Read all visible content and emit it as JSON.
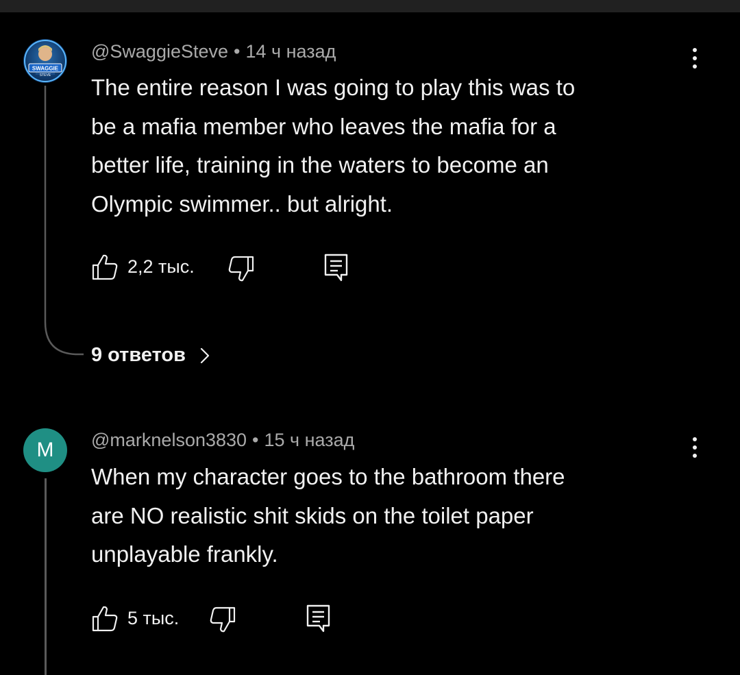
{
  "comments": [
    {
      "author": "@SwaggieSteve",
      "separator": "•",
      "time": "14 ч назад",
      "avatar_text": "SWAGGIE",
      "avatar_subtext": "STEVE",
      "text_lines": [
        "The entire reason I was going to play this was to",
        "be a mafia member who leaves the mafia for a",
        "better life, training in the waters to become an",
        "Olympic swimmer.. but alright."
      ],
      "likes": "2,2 тыс.",
      "replies_label": "9 ответов"
    },
    {
      "author": "@marknelson3830",
      "separator": "•",
      "time": "15 ч назад",
      "avatar_letter": "M",
      "text_lines": [
        "When my character goes to the bathroom there",
        "are NO realistic shit skids on the toilet paper",
        "unplayable frankly."
      ],
      "likes": "5 тыс."
    }
  ],
  "icons": {
    "like": "thumbs-up-outline",
    "dislike": "thumbs-down-outline",
    "reply": "comment-outline",
    "more": "vertical-ellipsis",
    "chevron": "chevron-right"
  },
  "colors": {
    "background": "#000000",
    "text": "#f1f1f1",
    "meta": "#aaaaaa",
    "avatar_m": "#1f8f84",
    "thread_line": "#5a5a5a"
  }
}
